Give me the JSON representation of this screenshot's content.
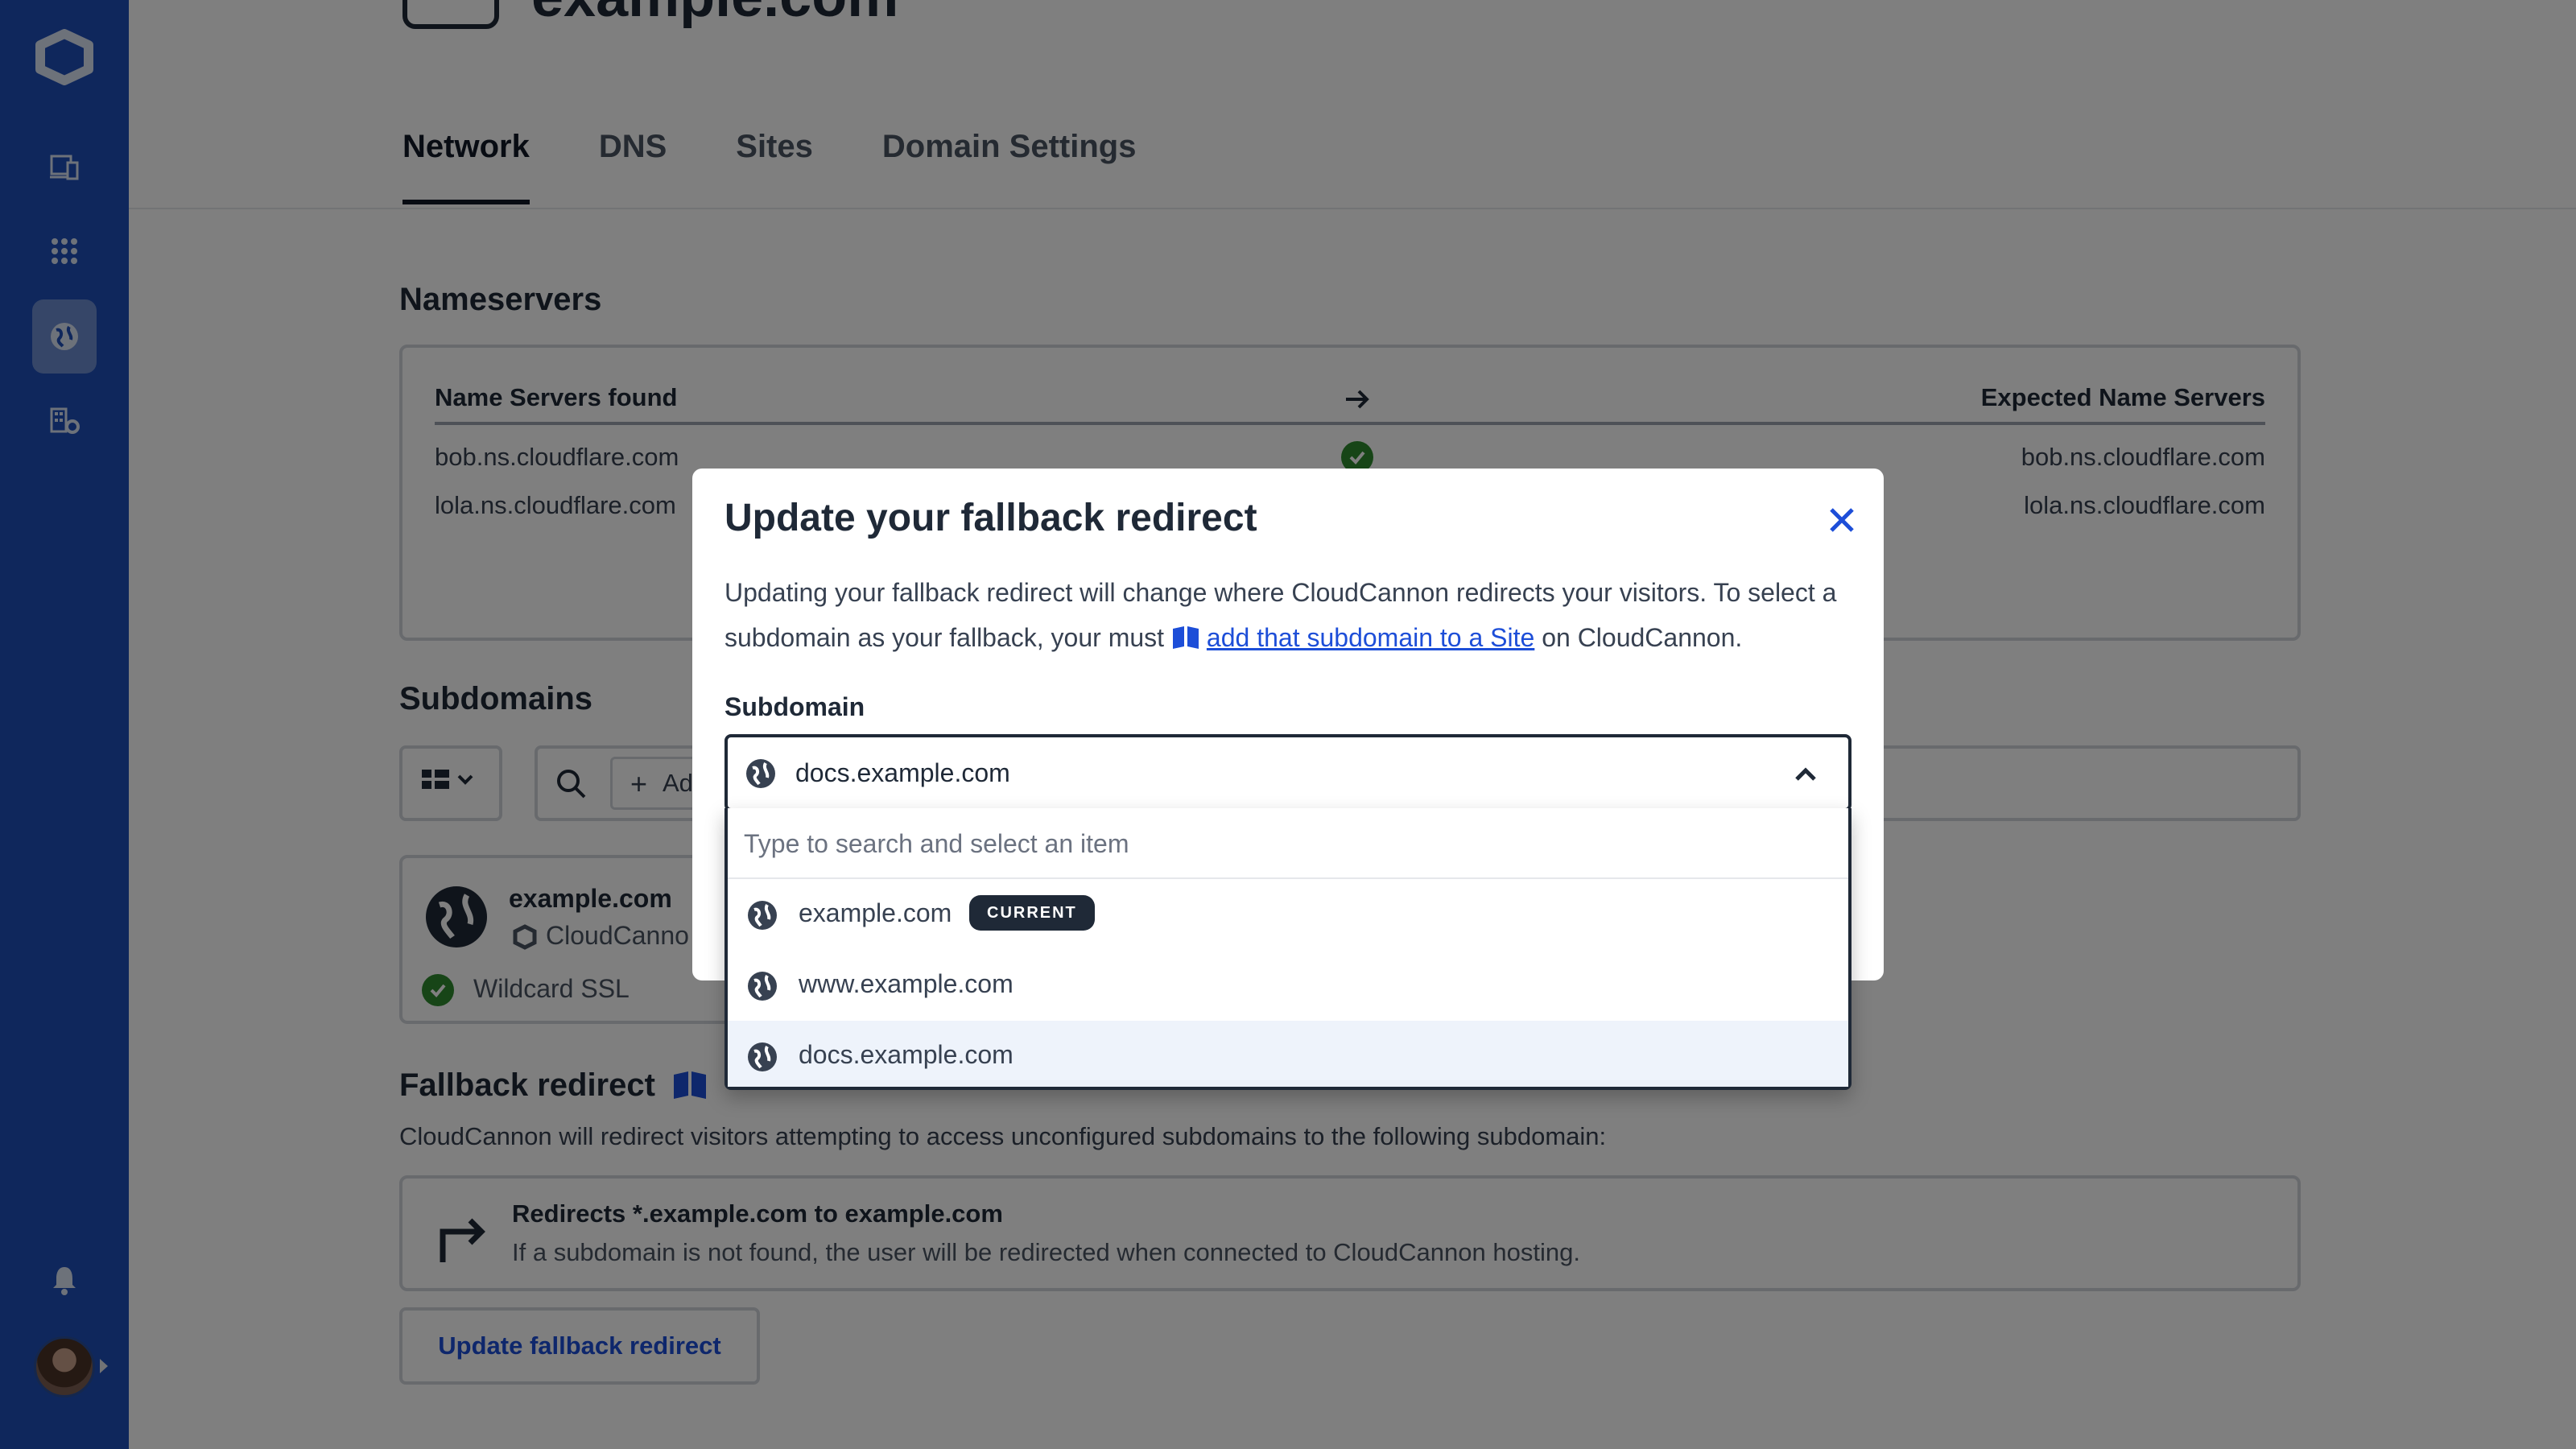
{
  "colors": {
    "sidebar": "#1f4fb8",
    "accent": "#1d4ed8",
    "success": "#2f8a2f",
    "overlay": "rgba(0,0,0,0.5)"
  },
  "sidebar": {
    "items": [
      {
        "icon": "devices-icon"
      },
      {
        "icon": "apps-grid-icon"
      },
      {
        "icon": "globe-icon",
        "active": true
      },
      {
        "icon": "org-settings-icon"
      }
    ],
    "notifications_icon": "bell-icon"
  },
  "page": {
    "domain_title": "example.com"
  },
  "tabs": [
    {
      "label": "Network",
      "active": true
    },
    {
      "label": "DNS"
    },
    {
      "label": "Sites"
    },
    {
      "label": "Domain Settings"
    }
  ],
  "nameservers": {
    "title": "Nameservers",
    "found_header": "Name Servers found",
    "expected_header": "Expected Name Servers",
    "found": [
      "bob.ns.cloudflare.com",
      "lola.ns.cloudflare.com"
    ],
    "expected": [
      "bob.ns.cloudflare.com",
      "lola.ns.cloudflare.com"
    ]
  },
  "subdomains": {
    "title": "Subdomains",
    "add_label": "Ad",
    "card": {
      "name": "example.com",
      "host": "CloudCanno",
      "ssl": "Wildcard SSL"
    }
  },
  "fallback": {
    "title": "Fallback redirect",
    "description": "CloudCannon will redirect visitors attempting to access unconfigured subdomains to the following subdomain:",
    "card_title": "Redirects *.example.com to example.com",
    "card_sub": "If a subdomain is not found, the user will be redirected when connected to CloudCannon hosting.",
    "button": "Update fallback redirect"
  },
  "modal": {
    "title": "Update your fallback redirect",
    "text_before": "Updating your fallback redirect will change where CloudCannon redirects your visitors. To select a subdomain as your fallback, your must ",
    "link": "add that subdomain to a Site",
    "text_after": " on CloudCannon.",
    "field_label": "Subdomain",
    "selected_value": "docs.example.com",
    "search_placeholder": "Type to search and select an item",
    "options": [
      {
        "label": "example.com",
        "badge": "CURRENT"
      },
      {
        "label": "www.example.com"
      },
      {
        "label": "docs.example.com",
        "highlighted": true
      }
    ]
  }
}
